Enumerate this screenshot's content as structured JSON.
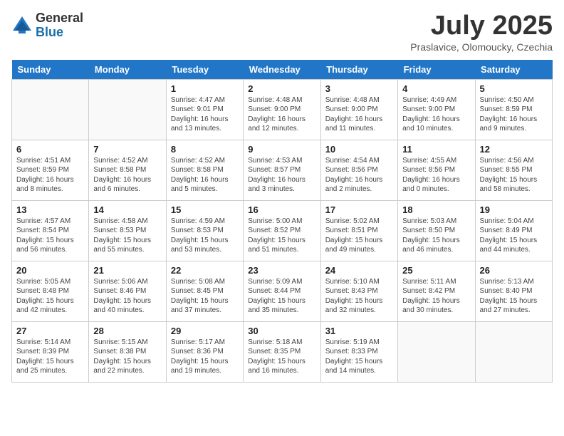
{
  "logo": {
    "general": "General",
    "blue": "Blue"
  },
  "title": "July 2025",
  "subtitle": "Praslavice, Olomoucky, Czechia",
  "days_header": [
    "Sunday",
    "Monday",
    "Tuesday",
    "Wednesday",
    "Thursday",
    "Friday",
    "Saturday"
  ],
  "weeks": [
    [
      {
        "day": "",
        "info": ""
      },
      {
        "day": "",
        "info": ""
      },
      {
        "day": "1",
        "info": "Sunrise: 4:47 AM\nSunset: 9:01 PM\nDaylight: 16 hours and 13 minutes."
      },
      {
        "day": "2",
        "info": "Sunrise: 4:48 AM\nSunset: 9:00 PM\nDaylight: 16 hours and 12 minutes."
      },
      {
        "day": "3",
        "info": "Sunrise: 4:48 AM\nSunset: 9:00 PM\nDaylight: 16 hours and 11 minutes."
      },
      {
        "day": "4",
        "info": "Sunrise: 4:49 AM\nSunset: 9:00 PM\nDaylight: 16 hours and 10 minutes."
      },
      {
        "day": "5",
        "info": "Sunrise: 4:50 AM\nSunset: 8:59 PM\nDaylight: 16 hours and 9 minutes."
      }
    ],
    [
      {
        "day": "6",
        "info": "Sunrise: 4:51 AM\nSunset: 8:59 PM\nDaylight: 16 hours and 8 minutes."
      },
      {
        "day": "7",
        "info": "Sunrise: 4:52 AM\nSunset: 8:58 PM\nDaylight: 16 hours and 6 minutes."
      },
      {
        "day": "8",
        "info": "Sunrise: 4:52 AM\nSunset: 8:58 PM\nDaylight: 16 hours and 5 minutes."
      },
      {
        "day": "9",
        "info": "Sunrise: 4:53 AM\nSunset: 8:57 PM\nDaylight: 16 hours and 3 minutes."
      },
      {
        "day": "10",
        "info": "Sunrise: 4:54 AM\nSunset: 8:56 PM\nDaylight: 16 hours and 2 minutes."
      },
      {
        "day": "11",
        "info": "Sunrise: 4:55 AM\nSunset: 8:56 PM\nDaylight: 16 hours and 0 minutes."
      },
      {
        "day": "12",
        "info": "Sunrise: 4:56 AM\nSunset: 8:55 PM\nDaylight: 15 hours and 58 minutes."
      }
    ],
    [
      {
        "day": "13",
        "info": "Sunrise: 4:57 AM\nSunset: 8:54 PM\nDaylight: 15 hours and 56 minutes."
      },
      {
        "day": "14",
        "info": "Sunrise: 4:58 AM\nSunset: 8:53 PM\nDaylight: 15 hours and 55 minutes."
      },
      {
        "day": "15",
        "info": "Sunrise: 4:59 AM\nSunset: 8:53 PM\nDaylight: 15 hours and 53 minutes."
      },
      {
        "day": "16",
        "info": "Sunrise: 5:00 AM\nSunset: 8:52 PM\nDaylight: 15 hours and 51 minutes."
      },
      {
        "day": "17",
        "info": "Sunrise: 5:02 AM\nSunset: 8:51 PM\nDaylight: 15 hours and 49 minutes."
      },
      {
        "day": "18",
        "info": "Sunrise: 5:03 AM\nSunset: 8:50 PM\nDaylight: 15 hours and 46 minutes."
      },
      {
        "day": "19",
        "info": "Sunrise: 5:04 AM\nSunset: 8:49 PM\nDaylight: 15 hours and 44 minutes."
      }
    ],
    [
      {
        "day": "20",
        "info": "Sunrise: 5:05 AM\nSunset: 8:48 PM\nDaylight: 15 hours and 42 minutes."
      },
      {
        "day": "21",
        "info": "Sunrise: 5:06 AM\nSunset: 8:46 PM\nDaylight: 15 hours and 40 minutes."
      },
      {
        "day": "22",
        "info": "Sunrise: 5:08 AM\nSunset: 8:45 PM\nDaylight: 15 hours and 37 minutes."
      },
      {
        "day": "23",
        "info": "Sunrise: 5:09 AM\nSunset: 8:44 PM\nDaylight: 15 hours and 35 minutes."
      },
      {
        "day": "24",
        "info": "Sunrise: 5:10 AM\nSunset: 8:43 PM\nDaylight: 15 hours and 32 minutes."
      },
      {
        "day": "25",
        "info": "Sunrise: 5:11 AM\nSunset: 8:42 PM\nDaylight: 15 hours and 30 minutes."
      },
      {
        "day": "26",
        "info": "Sunrise: 5:13 AM\nSunset: 8:40 PM\nDaylight: 15 hours and 27 minutes."
      }
    ],
    [
      {
        "day": "27",
        "info": "Sunrise: 5:14 AM\nSunset: 8:39 PM\nDaylight: 15 hours and 25 minutes."
      },
      {
        "day": "28",
        "info": "Sunrise: 5:15 AM\nSunset: 8:38 PM\nDaylight: 15 hours and 22 minutes."
      },
      {
        "day": "29",
        "info": "Sunrise: 5:17 AM\nSunset: 8:36 PM\nDaylight: 15 hours and 19 minutes."
      },
      {
        "day": "30",
        "info": "Sunrise: 5:18 AM\nSunset: 8:35 PM\nDaylight: 15 hours and 16 minutes."
      },
      {
        "day": "31",
        "info": "Sunrise: 5:19 AM\nSunset: 8:33 PM\nDaylight: 15 hours and 14 minutes."
      },
      {
        "day": "",
        "info": ""
      },
      {
        "day": "",
        "info": ""
      }
    ]
  ]
}
